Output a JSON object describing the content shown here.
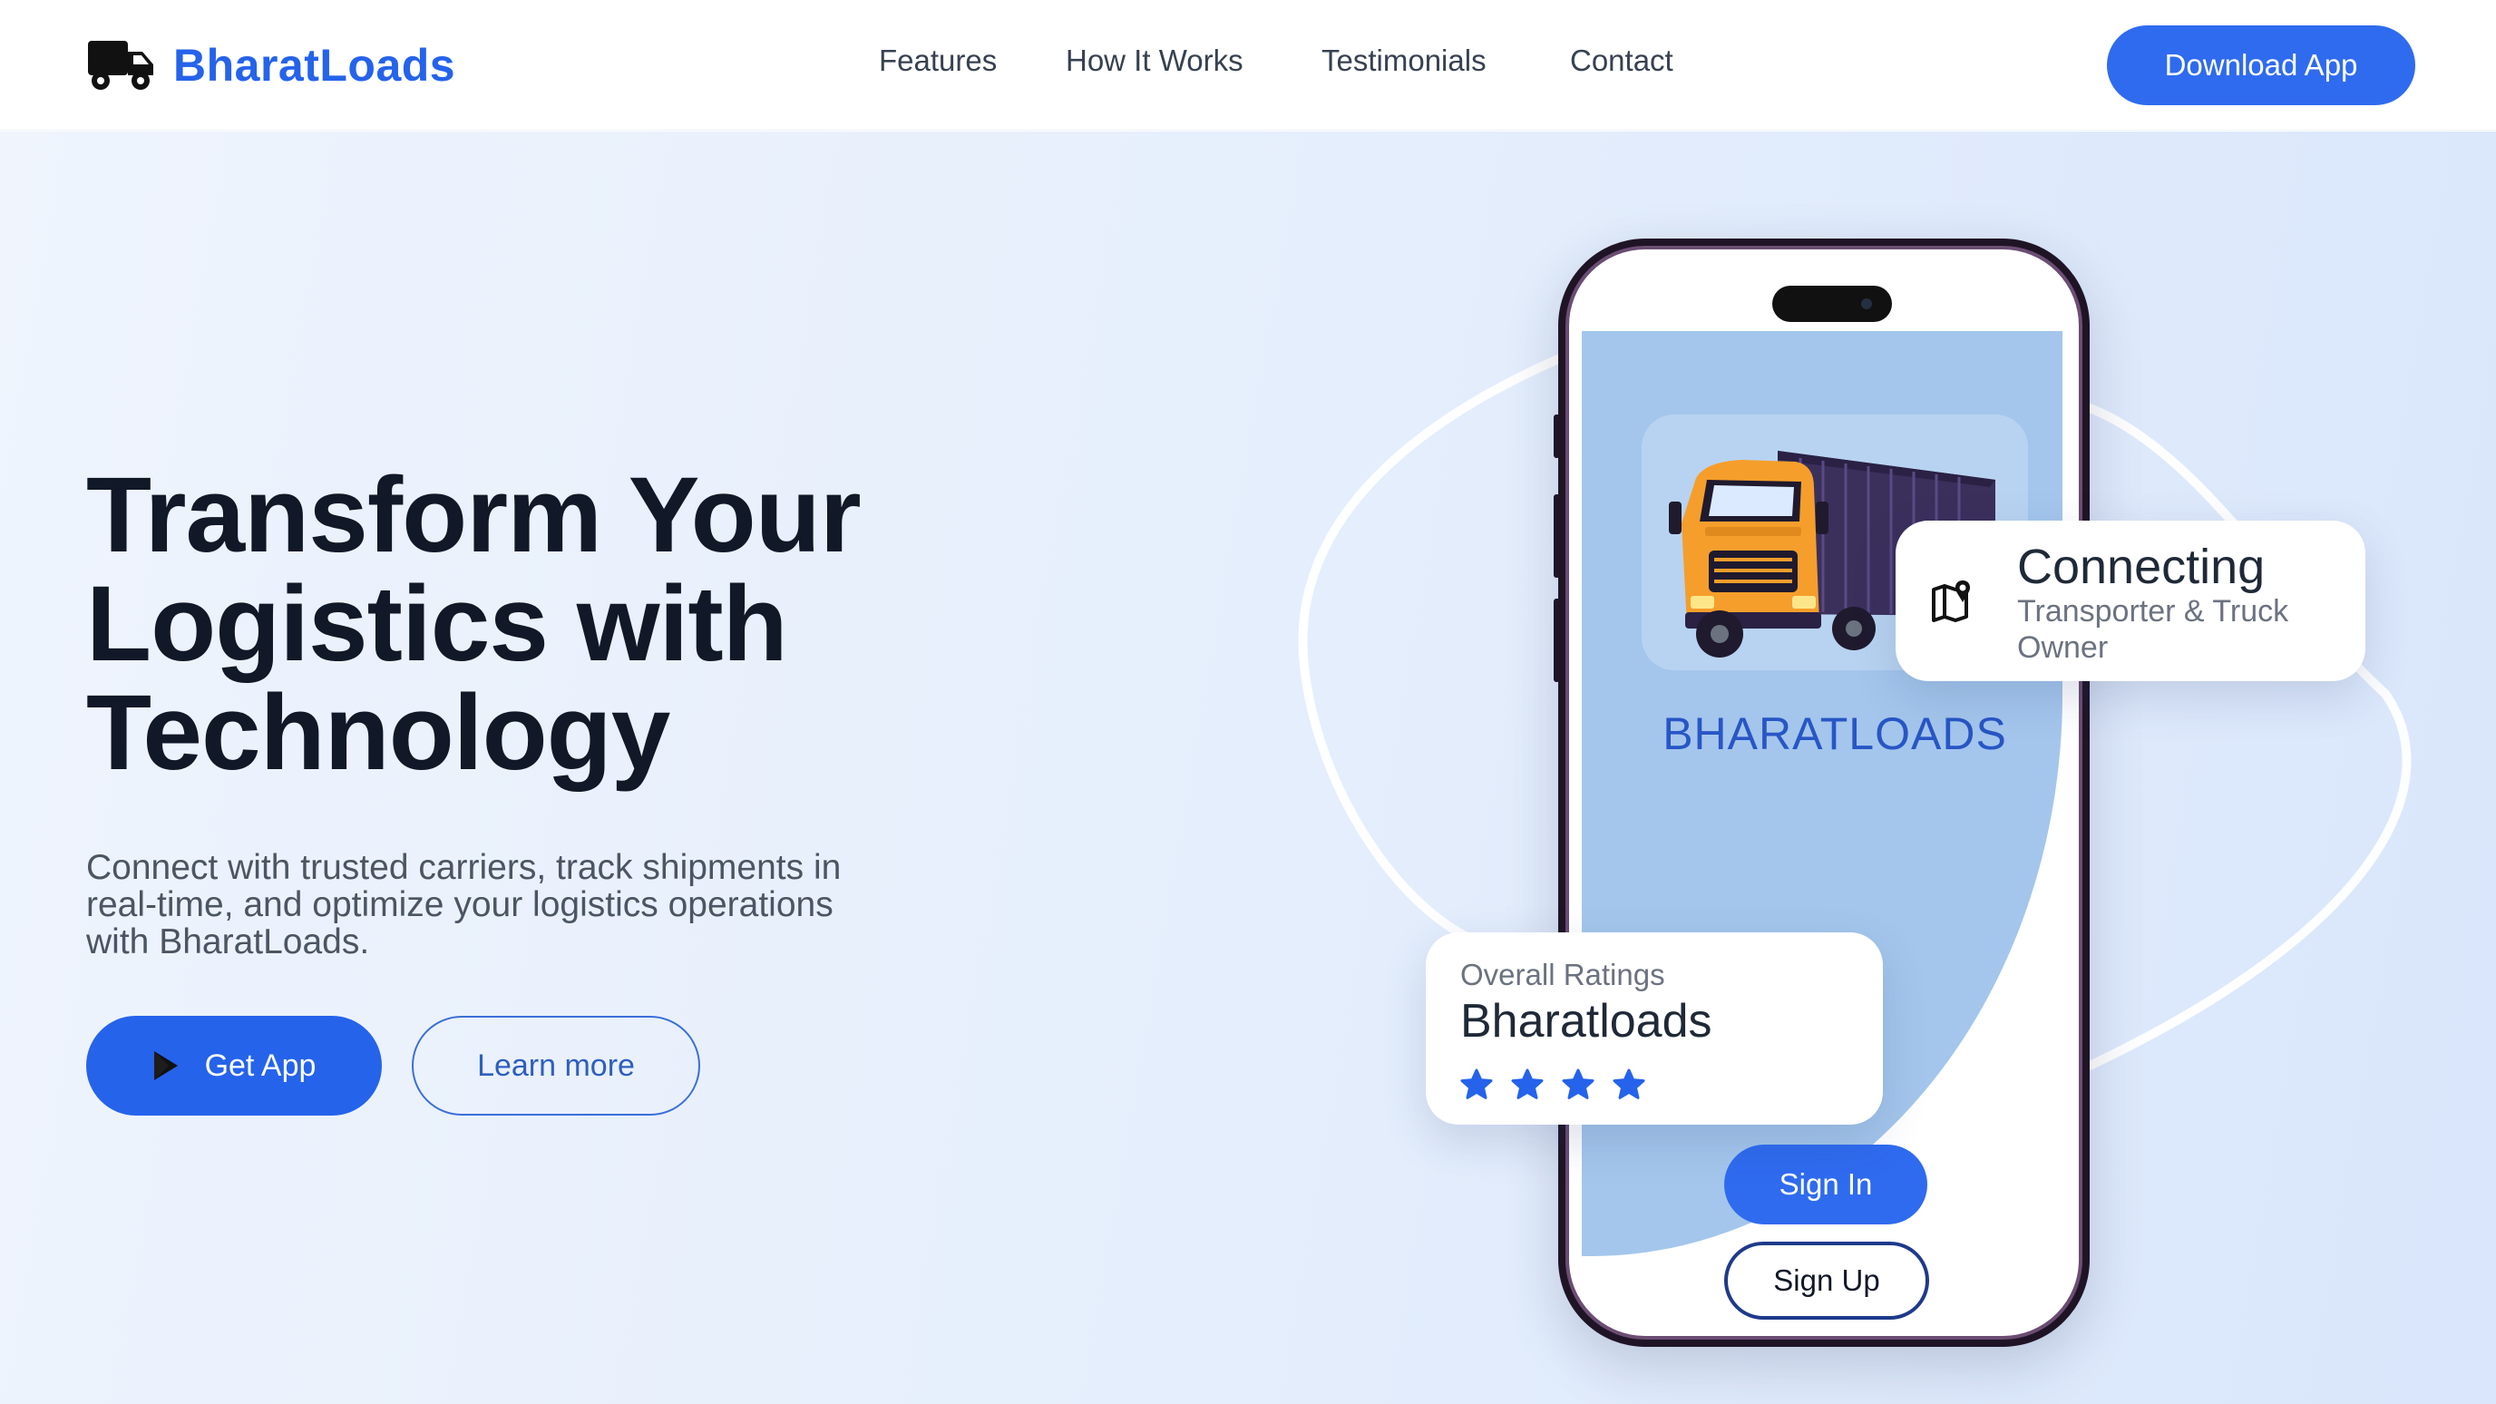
{
  "brand": {
    "name": "BharatLoads",
    "icon": "truck-icon",
    "color": "#2563eb"
  },
  "nav": {
    "links": [
      "Features",
      "How It Works",
      "Testimonials",
      "Contact"
    ],
    "cta": "Download App"
  },
  "hero": {
    "headline_lines": [
      "Transform Your",
      "Logistics with",
      "Technology"
    ],
    "subtitle_lines": [
      "Connect with trusted carriers, track shipments in",
      "real-time, and optimize your logistics operations",
      "with BharatLoads."
    ],
    "primary_button": {
      "label": "Get App",
      "icon": "play-store-icon"
    },
    "secondary_button": {
      "label": "Learn more"
    }
  },
  "phone": {
    "app_name": "BHARATLOADS",
    "app_image": "orange-truck-illustration",
    "sign_in": "Sign In",
    "sign_up": "Sign Up"
  },
  "connect_card": {
    "icon": "map-pin-icon",
    "title": "Connecting",
    "subtitle": "Transporter & Truck Owner"
  },
  "rating_card": {
    "label": "Overall Ratings",
    "name": "Bharatloads",
    "stars": 4,
    "star_icon": "star-icon"
  },
  "colors": {
    "accent": "#2563eb",
    "button_blue": "#2f6bef",
    "screen_blue": "#a4c6ec",
    "truck_orange": "#f59e2b",
    "trailer_purple": "#3b2f5c"
  }
}
